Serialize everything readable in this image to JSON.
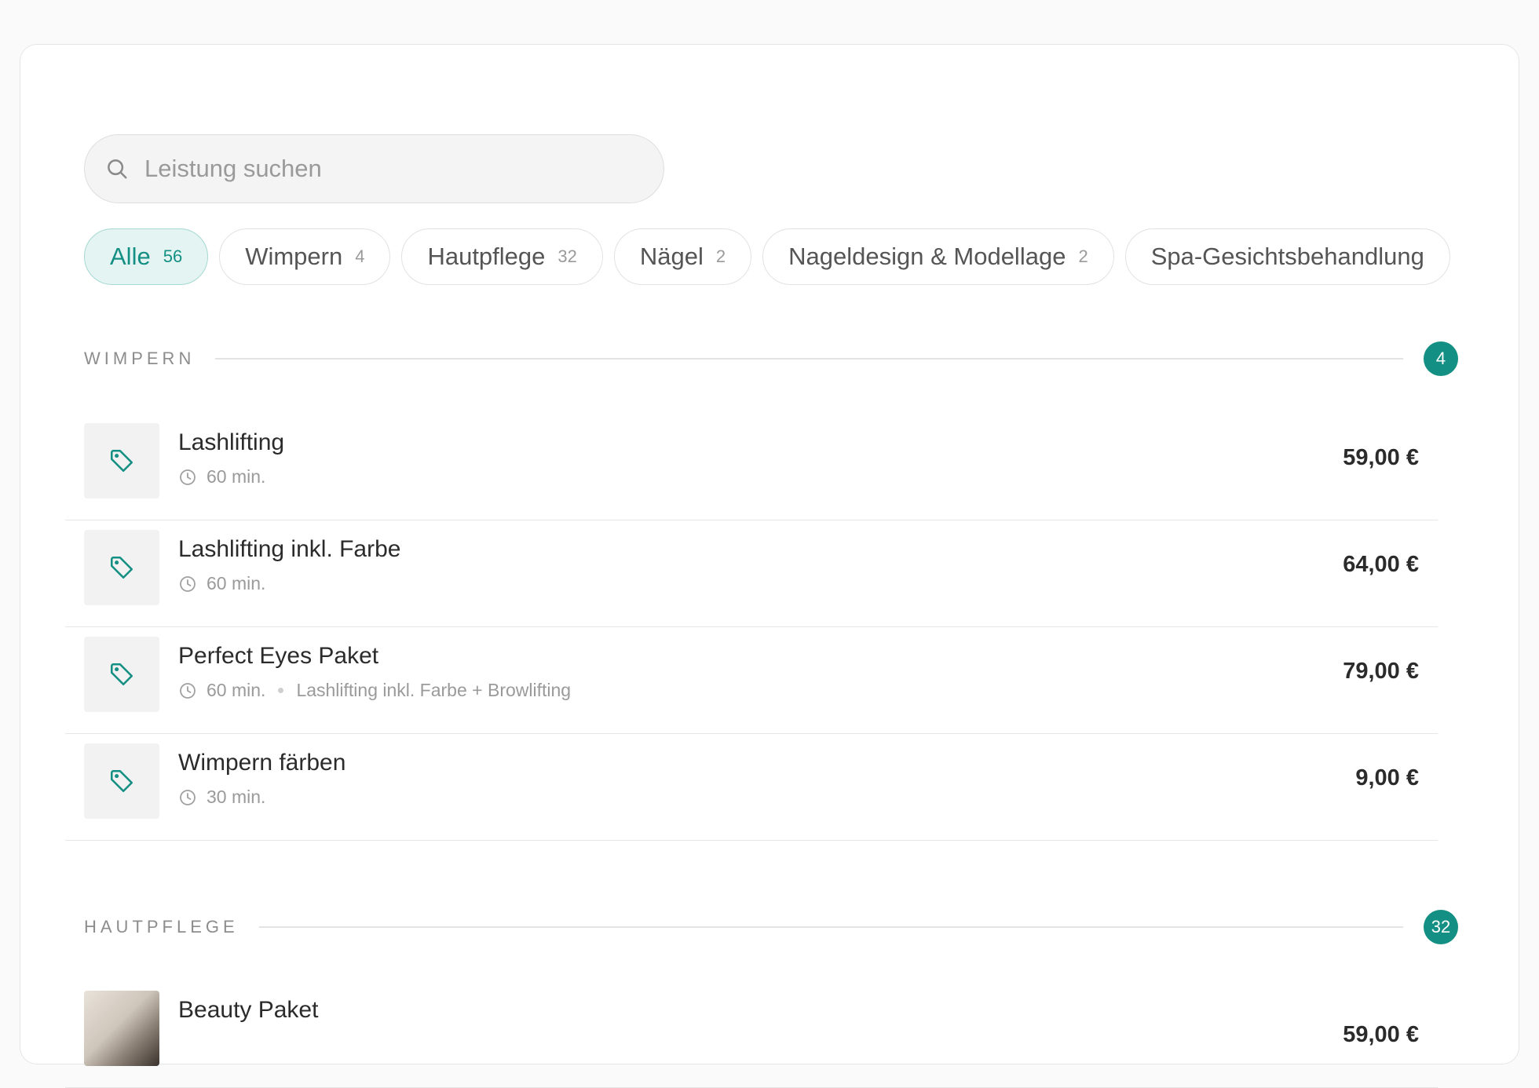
{
  "search": {
    "placeholder": "Leistung suchen",
    "value": ""
  },
  "filters": [
    {
      "label": "Alle",
      "count": "56",
      "active": true
    },
    {
      "label": "Wimpern",
      "count": "4",
      "active": false
    },
    {
      "label": "Hautpflege",
      "count": "32",
      "active": false
    },
    {
      "label": "Nägel",
      "count": "2",
      "active": false
    },
    {
      "label": "Nageldesign & Modellage",
      "count": "2",
      "active": false
    },
    {
      "label": "Spa-Gesichtsbehandlung",
      "count": "",
      "active": false
    }
  ],
  "sections": [
    {
      "title": "WIMPERN",
      "count": "4",
      "items": [
        {
          "name": "Lashlifting",
          "duration": "60 min.",
          "description": "",
          "price": "59,00 €",
          "icon": "tag-icon"
        },
        {
          "name": "Lashlifting inkl. Farbe",
          "duration": "60 min.",
          "description": "",
          "price": "64,00 €",
          "icon": "tag-icon"
        },
        {
          "name": "Perfect Eyes Paket",
          "duration": "60 min.",
          "description": "Lashlifting inkl. Farbe + Browlifting",
          "price": "79,00 €",
          "icon": "tag-icon"
        },
        {
          "name": "Wimpern färben",
          "duration": "30 min.",
          "description": "",
          "price": "9,00 €",
          "icon": "tag-icon"
        }
      ]
    },
    {
      "title": "HAUTPFLEGE",
      "count": "32",
      "items": [
        {
          "name": "Beauty Paket",
          "duration": "",
          "description": "",
          "price": "59,00 €",
          "icon": "photo"
        }
      ]
    }
  ],
  "colors": {
    "accent": "#148f83",
    "accent_light": "#e3f4f2",
    "muted_text": "#9a9a9a",
    "border": "#e6e6e6"
  }
}
